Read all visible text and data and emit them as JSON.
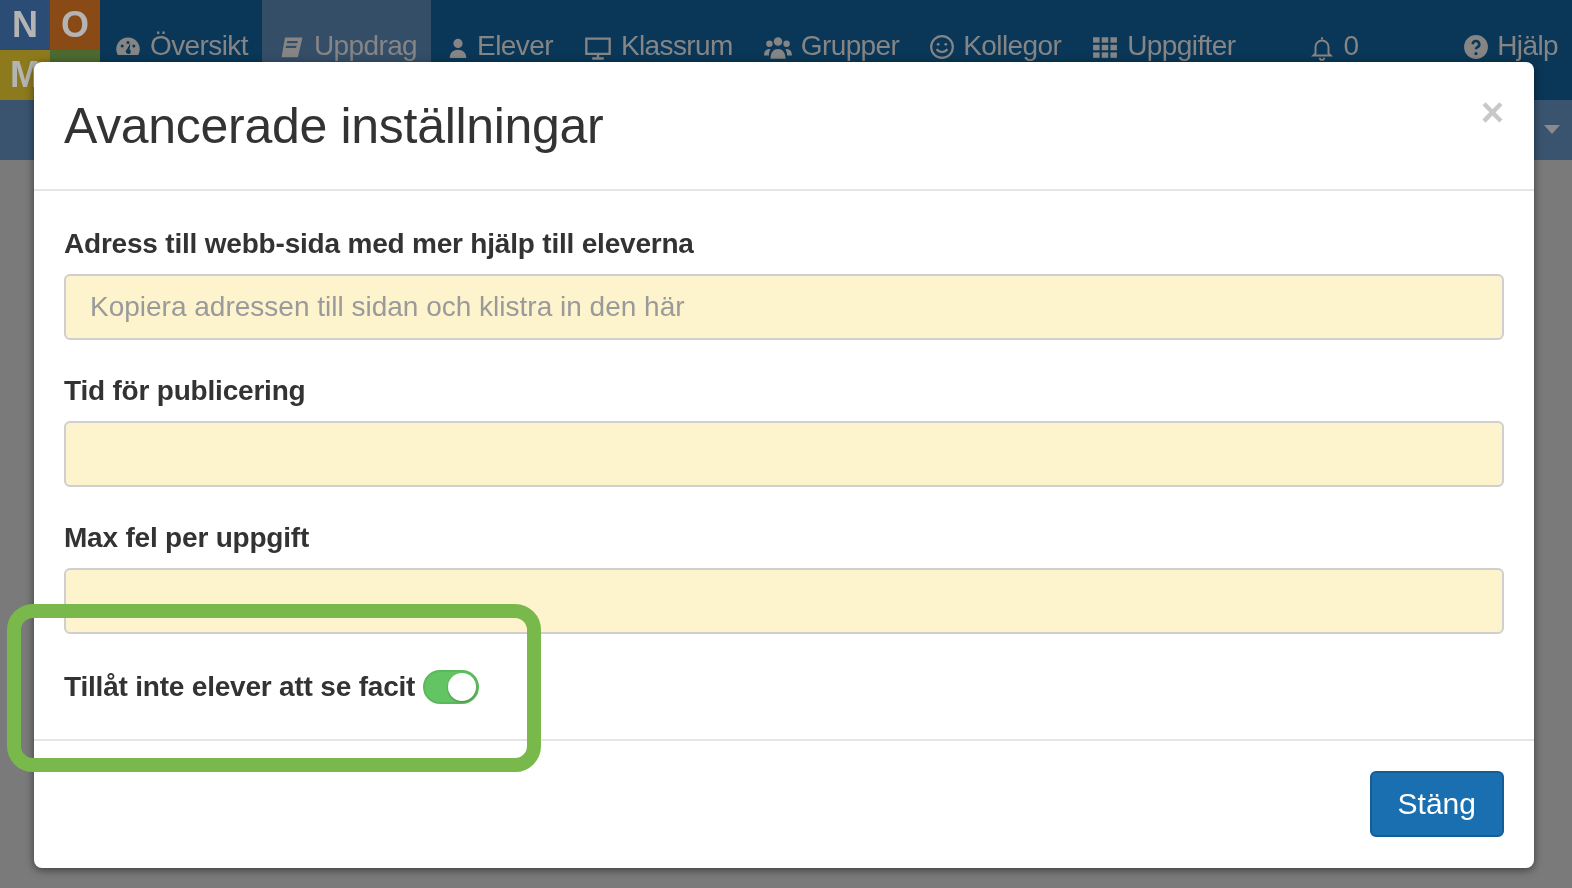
{
  "logo": {
    "letters": [
      {
        "text": "N",
        "color": "#2b4d75"
      },
      {
        "text": "O",
        "color": "#8a4a16"
      },
      {
        "text": "M",
        "color": "#8c7a1c"
      },
      {
        "color": "#4c6a30"
      }
    ]
  },
  "nav": {
    "items": [
      {
        "label": "Översikt",
        "selected": false
      },
      {
        "label": "Uppdrag",
        "selected": true
      },
      {
        "label": "Elever",
        "selected": false
      },
      {
        "label": "Klassrum",
        "selected": false
      },
      {
        "label": "Grupper",
        "selected": false
      },
      {
        "label": "Kollegor",
        "selected": false
      },
      {
        "label": "Uppgifter",
        "selected": false
      },
      {
        "label": "0",
        "selected": false
      },
      {
        "label": "Hjälp",
        "selected": false
      }
    ]
  },
  "modal": {
    "title": "Avancerade inställningar",
    "close": "×",
    "fields": [
      {
        "label": "Adress till webb-sida med mer hjälp till eleverna",
        "placeholder": "Kopiera adressen till sidan och klistra in den här"
      },
      {
        "label": "Tid för publicering"
      },
      {
        "label": "Max fel per uppgift"
      }
    ],
    "toggle": {
      "label": "Tillåt inte elever att se facit",
      "on": true
    },
    "buttons": [
      "Stäng"
    ]
  }
}
